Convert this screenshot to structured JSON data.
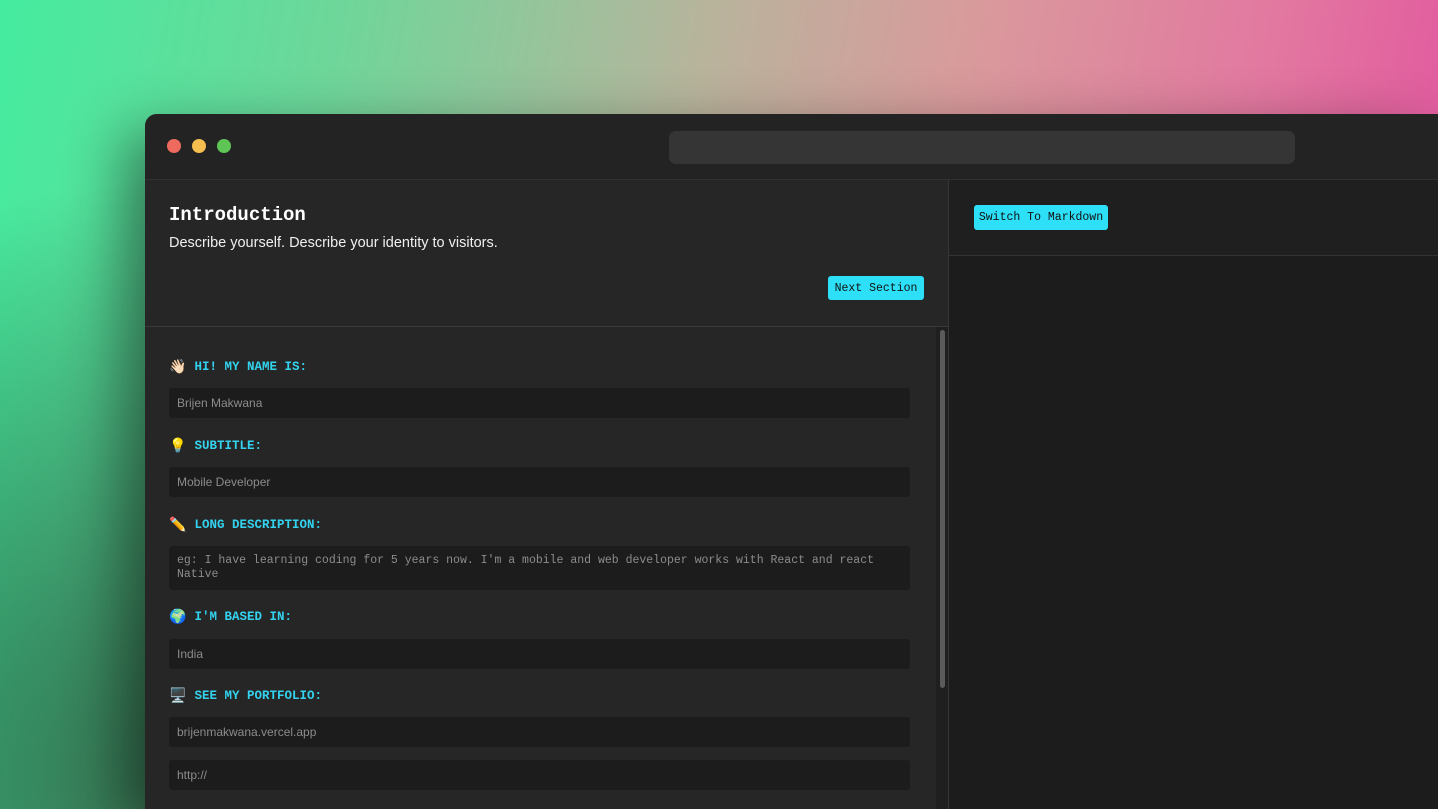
{
  "window": {
    "controls": [
      "close",
      "minimize",
      "maximize"
    ],
    "url_bar": ""
  },
  "editor": {
    "section_title": "Introduction",
    "section_description": "Describe yourself. Describe your identity to visitors.",
    "next_button": "Next Section",
    "fields": [
      {
        "icon": "👋🏻",
        "label": "HI! MY NAME IS:",
        "placeholder": "Brijen Makwana"
      },
      {
        "icon": "💡",
        "label": "SUBTITLE:",
        "placeholder": "Mobile Developer"
      },
      {
        "icon": "✏️",
        "label": "LONG DESCRIPTION:",
        "placeholder": "eg: I have learning coding for 5 years now. I'm a mobile and web developer works with React and react Native"
      },
      {
        "icon": "🌍",
        "label": "I'M BASED IN:",
        "placeholder": "India"
      },
      {
        "icon": "🖥️",
        "label": "SEE MY PORTFOLIO:",
        "placeholder": "brijenmakwana.vercel.app",
        "placeholder2": "http://"
      }
    ]
  },
  "preview": {
    "switch_button": "Switch To Markdown"
  },
  "colors": {
    "accent": "#2de0f7",
    "label": "#33d3ef",
    "window_bg": "#262626",
    "input_bg": "#1c1c1c"
  }
}
